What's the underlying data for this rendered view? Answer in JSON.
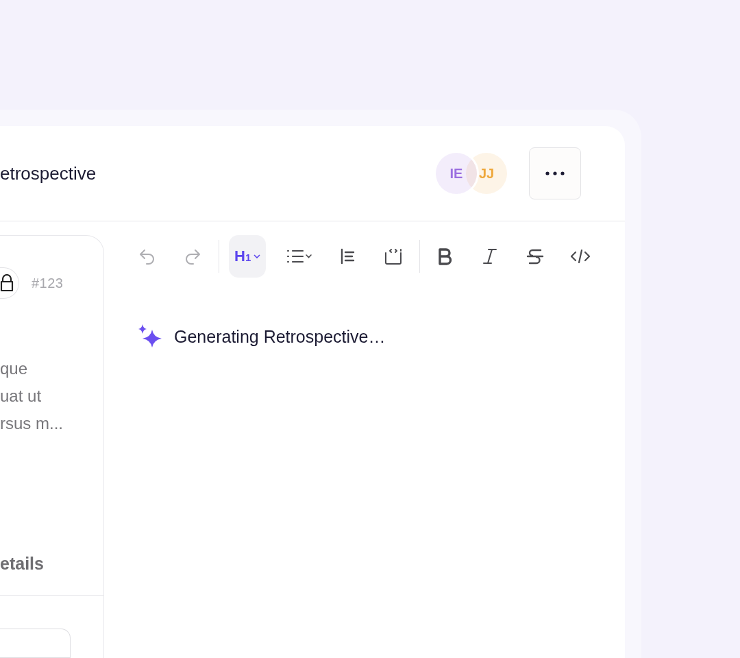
{
  "header": {
    "title": "etrospective",
    "avatars": [
      {
        "initials": "IE",
        "color": "#9b6fe0"
      },
      {
        "initials": "JJ",
        "color": "#eea73a"
      }
    ]
  },
  "side_panel": {
    "issue_number": "#123",
    "description_lines": [
      "que",
      "uat ut",
      "rsus m..."
    ],
    "section_heading": "etails"
  },
  "toolbar": [
    {
      "kind": "undo",
      "disabled": true,
      "selected": false
    },
    {
      "kind": "redo",
      "disabled": true,
      "selected": false
    },
    {
      "kind": "separator"
    },
    {
      "kind": "heading",
      "label": "H$_{1}$",
      "disabled": false,
      "selected": true
    },
    {
      "kind": "bullet-list",
      "disabled": false,
      "selected": false
    },
    {
      "kind": "align",
      "disabled": false,
      "selected": false
    },
    {
      "kind": "code-block",
      "disabled": false,
      "selected": false
    },
    {
      "kind": "separator"
    },
    {
      "kind": "bold",
      "disabled": false,
      "selected": false
    },
    {
      "kind": "italic",
      "disabled": false,
      "selected": false
    },
    {
      "kind": "strike",
      "disabled": false,
      "selected": false
    },
    {
      "kind": "code",
      "disabled": false,
      "selected": false
    }
  ],
  "editor": {
    "status": "Generating Retrospective…"
  }
}
